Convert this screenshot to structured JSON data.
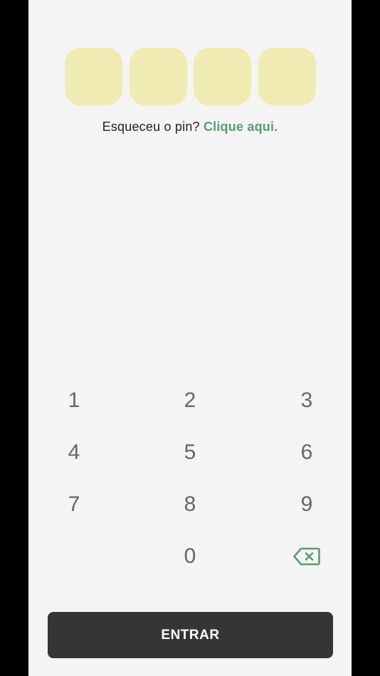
{
  "pin": {
    "box_color": "#efebb3",
    "boxes": [
      "",
      "",
      "",
      ""
    ]
  },
  "forgot": {
    "text": "Esqueceu o pin?",
    "link": "Clique aqui.",
    "link_color": "#5b9b72"
  },
  "keypad": {
    "keys": [
      "1",
      "2",
      "3",
      "4",
      "5",
      "6",
      "7",
      "8",
      "9",
      "0"
    ],
    "backspace_icon": "backspace-icon",
    "backspace_color": "#5b9b72"
  },
  "enter": {
    "label": "ENTRAR",
    "color": "#353535"
  }
}
